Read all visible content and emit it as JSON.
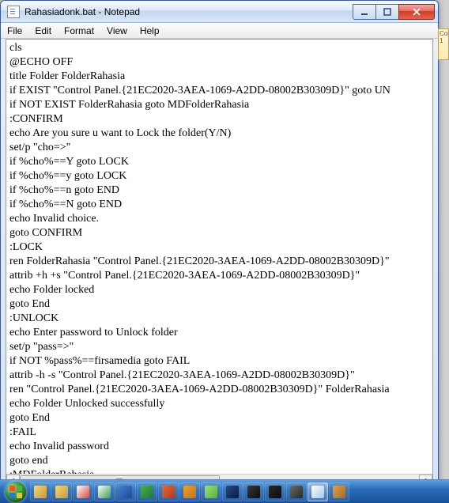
{
  "window": {
    "title": "Rahasiadonk.bat - Notepad"
  },
  "menu": {
    "file": "File",
    "edit": "Edit",
    "format": "Format",
    "view": "View",
    "help": "Help"
  },
  "editor": {
    "content": "cls\n@ECHO OFF\ntitle Folder FolderRahasia\nif EXIST \"Control Panel.{21EC2020-3AEA-1069-A2DD-08002B30309D}\" goto UN\nif NOT EXIST FolderRahasia goto MDFolderRahasia\n:CONFIRM\necho Are you sure u want to Lock the folder(Y/N)\nset/p \"cho=>\"\nif %cho%==Y goto LOCK\nif %cho%==y goto LOCK\nif %cho%==n goto END\nif %cho%==N goto END\necho Invalid choice.\ngoto CONFIRM\n:LOCK\nren FolderRahasia \"Control Panel.{21EC2020-3AEA-1069-A2DD-08002B30309D}\"\nattrib +h +s \"Control Panel.{21EC2020-3AEA-1069-A2DD-08002B30309D}\"\necho Folder locked\ngoto End\n:UNLOCK\necho Enter password to Unlock folder\nset/p \"pass=>\"\nif NOT %pass%==firsamedia goto FAIL\nattrib -h -s \"Control Panel.{21EC2020-3AEA-1069-A2DD-08002B30309D}\"\nren \"Control Panel.{21EC2020-3AEA-1069-A2DD-08002B30309D}\" FolderRahasia\necho Folder Unlocked successfully\ngoto End\n:FAIL\necho Invalid password\ngoto end\n:MDFolderRahasia"
  },
  "side": {
    "col_label": "Col",
    "col_value": "1"
  },
  "taskbar": {
    "items": [
      {
        "name": "explorer",
        "color1": "#f6d77a",
        "color2": "#c9953a"
      },
      {
        "name": "explorer",
        "color1": "#f6d77a",
        "color2": "#c9953a"
      },
      {
        "name": "chrome",
        "color1": "#ffffff",
        "color2": "#d44a3a"
      },
      {
        "name": "chrome",
        "color1": "#ffffff",
        "color2": "#3a9c4a"
      },
      {
        "name": "word",
        "color1": "#4a7ac9",
        "color2": "#1a4a9a"
      },
      {
        "name": "excel",
        "color1": "#4aae5a",
        "color2": "#1a7a2a"
      },
      {
        "name": "powerpoint",
        "color1": "#e06a3a",
        "color2": "#b03a1a"
      },
      {
        "name": "winamp",
        "color1": "#f0a02a",
        "color2": "#c0701a"
      },
      {
        "name": "notepadpp",
        "color1": "#9ae07a",
        "color2": "#5aae3a"
      },
      {
        "name": "photoshop",
        "color1": "#2a4a8a",
        "color2": "#0a1a3a"
      },
      {
        "name": "github",
        "color1": "#3a3a3a",
        "color2": "#0a0a0a"
      },
      {
        "name": "app",
        "color1": "#2a2a2a",
        "color2": "#0a0a0a"
      },
      {
        "name": "app",
        "color1": "#6a6a6a",
        "color2": "#2a2a2a"
      },
      {
        "name": "notepad",
        "color1": "#ffffff",
        "color2": "#a0c8e8",
        "active": true
      },
      {
        "name": "app",
        "color1": "#e0a04a",
        "color2": "#a06a2a"
      }
    ]
  }
}
